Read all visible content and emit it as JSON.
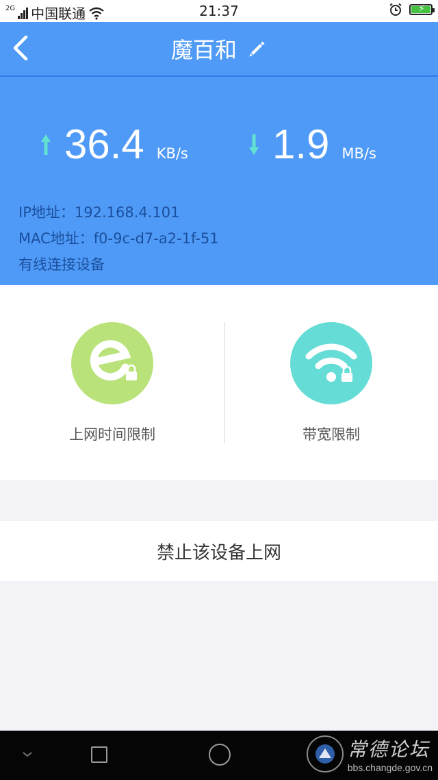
{
  "status_bar": {
    "network_type": "2G",
    "carrier": "中国联通",
    "time": "21:37"
  },
  "header": {
    "title": "魔百和"
  },
  "speed": {
    "upload_value": "36.4",
    "upload_unit": "KB/s",
    "download_value": "1.9",
    "download_unit": "MB/s"
  },
  "device_info": {
    "ip": "IP地址：192.168.4.101",
    "mac": "MAC地址：f0-9c-d7-a2-1f-51",
    "connection": "有线连接设备"
  },
  "actions": [
    {
      "label": "上网时间限制",
      "icon": "internet-lock-icon",
      "color": "#b9e27a"
    },
    {
      "label": "带宽限制",
      "icon": "wifi-lock-icon",
      "color": "#66dcd6"
    }
  ],
  "ban_button": {
    "label": "禁止该设备上网"
  },
  "watermark": {
    "title": "常德论坛",
    "url": "bbs.changde.gov.cn"
  },
  "colors": {
    "primary": "#4f9af6",
    "info_text": "#1a4f9e",
    "arrow": "#62e3d1",
    "background": "#f2f2f7"
  }
}
